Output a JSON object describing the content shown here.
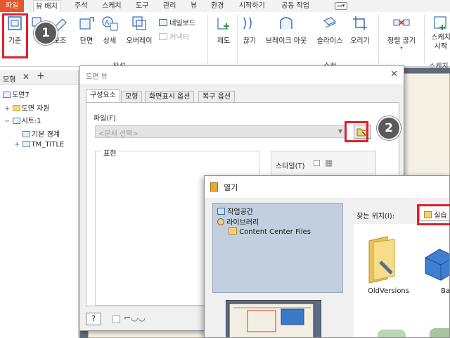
{
  "ribbon_tabs": [
    "파일",
    "뷰 배치",
    "주석",
    "스케치",
    "도구",
    "관리",
    "뷰",
    "환경",
    "시작하기",
    "공동 작업"
  ],
  "ribbon_buttons": {
    "base": "기준",
    "projected": "투영",
    "auxiliary": "보조",
    "section": "단면",
    "detail": "상세",
    "overlay": "오버레이",
    "nailboard": "네일보드",
    "connector": "커넥터",
    "draft": "제도",
    "break": "끊기",
    "breakout": "브레이크 아웃",
    "slice": "슬라이스",
    "crop": "오리기",
    "align": "정렬 끊기",
    "start_sketch": "스케치\n시작"
  },
  "ribbon_panels": {
    "create": "작성",
    "modify": "수정",
    "sketch": "스케치"
  },
  "browser": {
    "tab": "모형",
    "items": [
      "도면7",
      "도면 자원",
      "시트:1",
      "기본 경계",
      "TM_TITLE"
    ]
  },
  "drawing_view_dialog": {
    "title": "도면 뷰",
    "tabs": [
      "구성요소",
      "모형",
      "화면표시 옵션",
      "복구 옵션"
    ],
    "file_label": "파일(F)",
    "file_placeholder": "<문서 선택>",
    "representation_label": "표현",
    "style_label": "스타일(T)"
  },
  "open_dialog": {
    "title": "열기",
    "locations": [
      "작업공간",
      "라이브러리",
      "Content Center Files"
    ],
    "look_in_label": "찾는 위치(I):",
    "look_in_value": "실습",
    "files": [
      "OldVersions",
      "Bas"
    ]
  },
  "callouts": [
    "1",
    "2"
  ],
  "colors": {
    "file_tab": "#e4572e",
    "highlight": "#e0202a",
    "badge": "#5a5a5a",
    "location_panel": "#c2cfde",
    "canvas": "#5f6a78"
  }
}
